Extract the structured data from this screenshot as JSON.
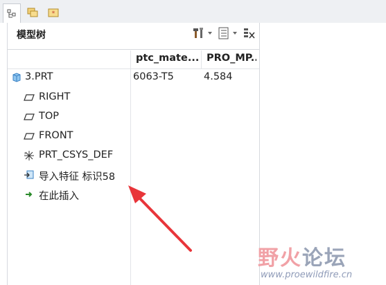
{
  "panel": {
    "title": "模型树"
  },
  "columns": [
    {
      "header": "ptc_mate..."
    },
    {
      "header": "PRO_MP..."
    }
  ],
  "tree": {
    "root": {
      "label": "3.PRT",
      "icon": "part-icon",
      "material": "6063-T5",
      "mass": "4.584"
    },
    "items": [
      {
        "label": "RIGHT",
        "icon": "datum-plane-icon"
      },
      {
        "label": "TOP",
        "icon": "datum-plane-icon"
      },
      {
        "label": "FRONT",
        "icon": "datum-plane-icon"
      },
      {
        "label": "PRT_CSYS_DEF",
        "icon": "coordinate-system-icon"
      },
      {
        "label": "导入特征 标识58",
        "icon": "import-feature-icon"
      },
      {
        "label": "在此插入",
        "icon": "insert-here-arrow-icon"
      }
    ]
  },
  "watermark": {
    "logo_part1": "野火",
    "logo_part2": "论坛",
    "url": "www.proewildfire.cn"
  },
  "colors": {
    "annotation_arrow": "#e8353a",
    "insert_arrow": "#2a8a2a",
    "part_icon": "#5aa9e6"
  }
}
